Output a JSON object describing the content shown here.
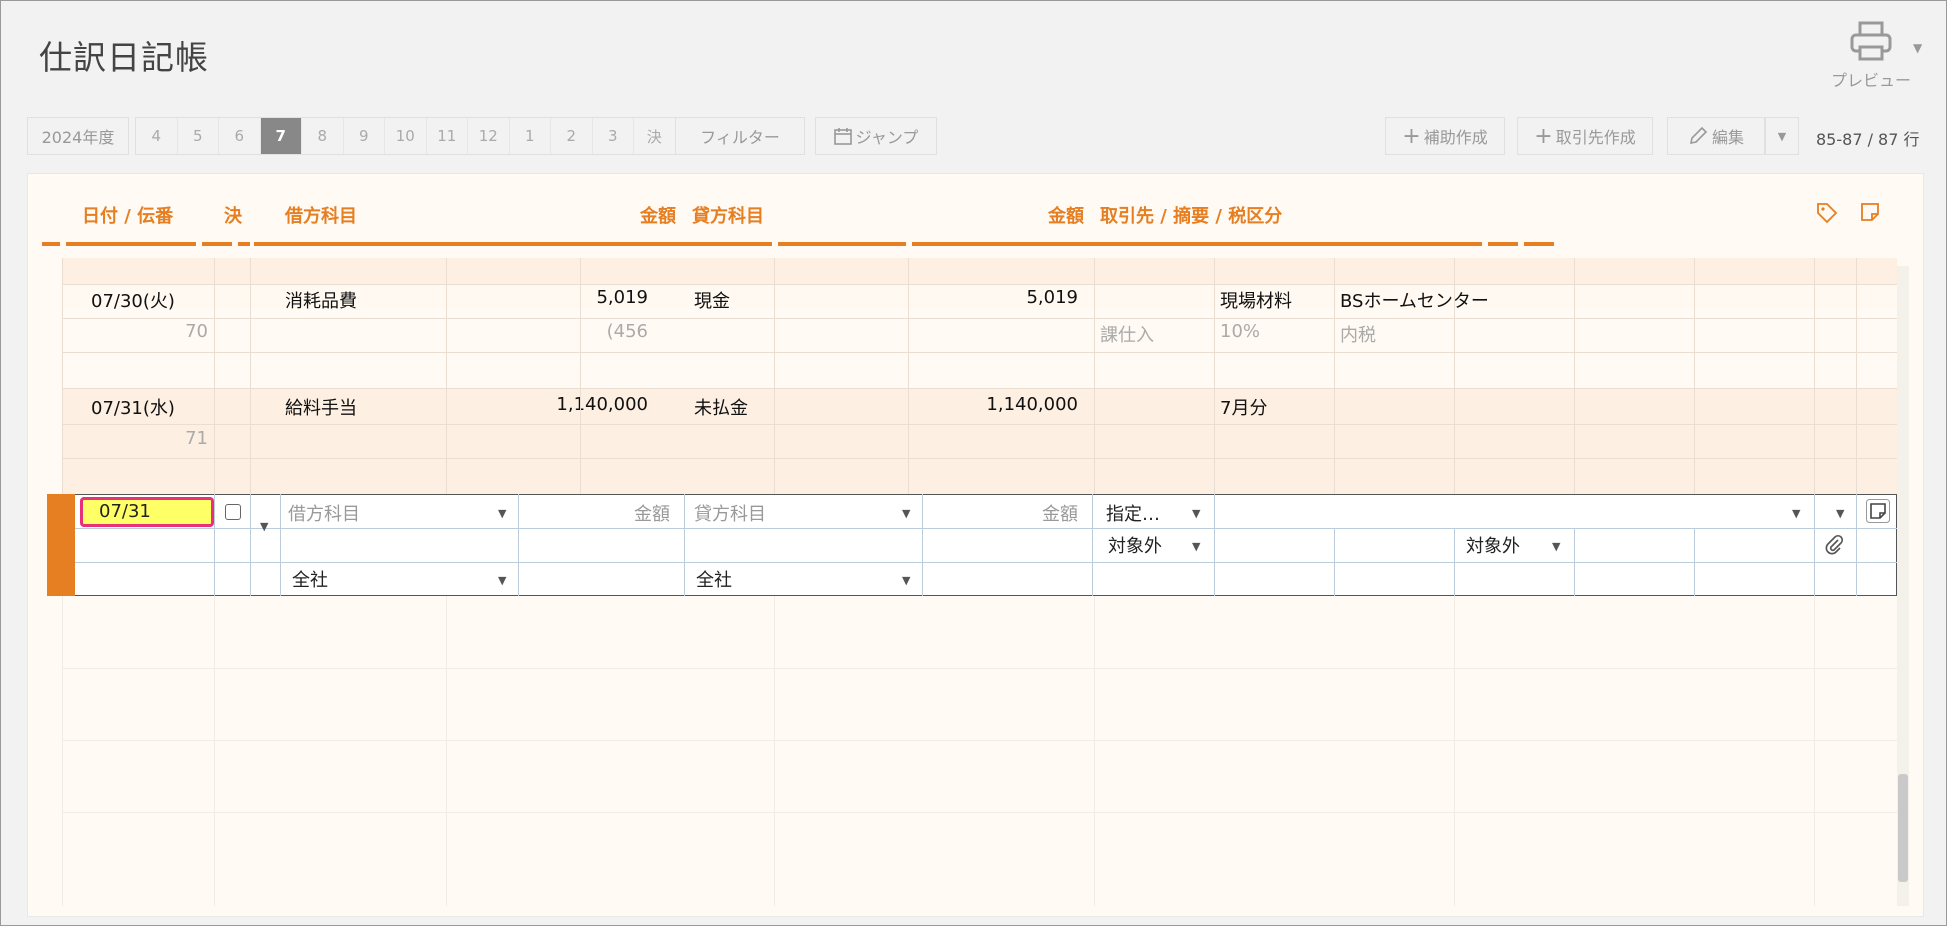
{
  "page_title": "仕訳日記帳",
  "preview_label": "プレビュー",
  "year_label": "2024年度",
  "months": [
    "4",
    "5",
    "6",
    "7",
    "8",
    "9",
    "10",
    "11",
    "12",
    "1",
    "2",
    "3",
    "決"
  ],
  "active_month": "7",
  "filter_label": "フィルター",
  "jump_label": "ジャンプ",
  "add_sub_label": "補助作成",
  "add_partner_label": "取引先作成",
  "edit_label": "編集",
  "row_count": "85-87 / 87 行",
  "headers": {
    "date": "日付 / 伝番",
    "settle": "決",
    "debit_account": "借方科目",
    "debit_amount": "金額",
    "credit_account": "貸方科目",
    "credit_amount": "金額",
    "partner": "取引先 / 摘要 / 税区分"
  },
  "rows": [
    {
      "date": "07/30(火)",
      "number": "70",
      "debit_account": "消耗品費",
      "debit_amount": "5,019",
      "tax_amount": "(456",
      "credit_account": "現金",
      "credit_amount": "5,019",
      "tax_class": "課仕入",
      "tax_rate": "10%",
      "tax_type": "内税",
      "memo": "現場材料",
      "partner": "BSホームセンター"
    },
    {
      "date": "07/31(水)",
      "number": "71",
      "debit_account": "給料手当",
      "debit_amount": "1,140,000",
      "credit_account": "未払金",
      "credit_amount": "1,140,000",
      "memo": "7月分"
    }
  ],
  "entry": {
    "date_value": "07/31",
    "debit_account_placeholder": "借方科目",
    "debit_amount_placeholder": "金額",
    "credit_account_placeholder": "貸方科目",
    "credit_amount_placeholder": "金額",
    "partner_select": "指定…",
    "tax_debit": "対象外",
    "tax_credit": "対象外",
    "dept_debit": "全社",
    "dept_credit": "全社"
  },
  "colors": {
    "accent": "#e67e22",
    "highlight": "#ffff66",
    "focus_border": "#e8317a"
  }
}
